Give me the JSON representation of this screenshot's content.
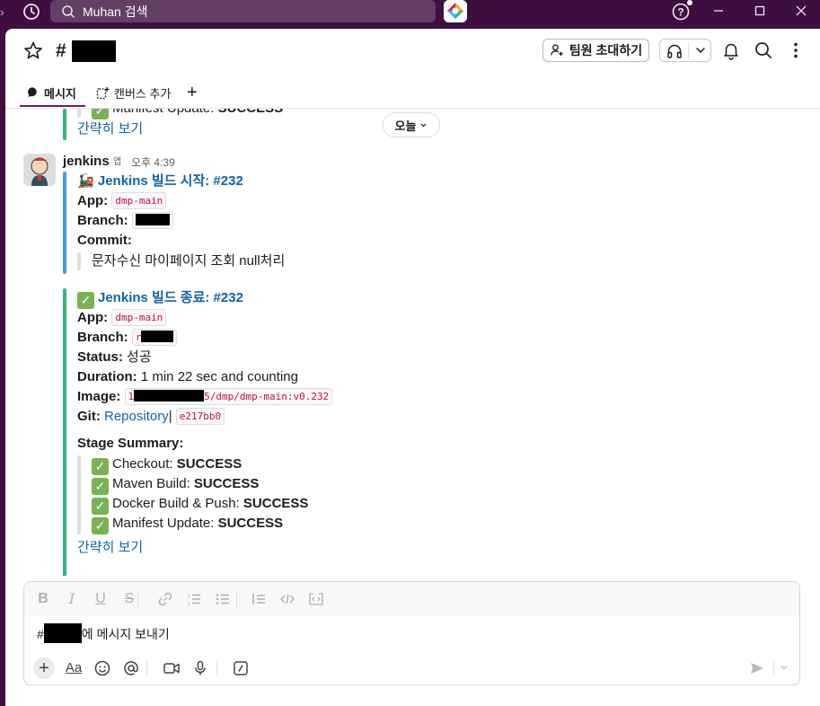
{
  "topbar": {
    "search_text": "Muhan 검색"
  },
  "header": {
    "hash": "#",
    "invite_label": "팀원 초대하기"
  },
  "tabs": {
    "messages": "메시지",
    "canvas": "캔버스 추가",
    "add": "+"
  },
  "date_pill": "오늘",
  "prev_message": {
    "manifest_label": "Manifest Update: ",
    "manifest_status": "SUCCESS",
    "collapse": "간략히 보기"
  },
  "message": {
    "sender": "jenkins",
    "badge": "앱",
    "time": "오후 4:39",
    "start": {
      "title": "Jenkins 빌드 시작: #232",
      "app_label": "App:",
      "app_value": "dmp-main",
      "branch_label": "Branch:",
      "commit_label": "Commit:",
      "commit_text": "문자수신 마이페이지 조회 null처리"
    },
    "finish": {
      "title": "Jenkins 빌드 종료: #232",
      "app_label": "App:",
      "app_value": "dmp-main",
      "branch_label": "Branch:",
      "branch_visible": "r",
      "status_label": "Status:",
      "status_value": "성공",
      "duration_label": "Duration:",
      "duration_value": "1 min 22 sec and counting",
      "image_label": "Image:",
      "image_prefix": "1",
      "image_suffix": "5/dmp/dmp-main:v0.232",
      "git_label": "Git:",
      "git_link": "Repository",
      "git_sep": "|",
      "git_commit": "e217bb0",
      "summary_label": "Stage Summary:",
      "stages": [
        {
          "name": "Checkout: ",
          "status": "SUCCESS"
        },
        {
          "name": "Maven Build: ",
          "status": "SUCCESS"
        },
        {
          "name": "Docker Build & Push: ",
          "status": "SUCCESS"
        },
        {
          "name": "Manifest Update: ",
          "status": "SUCCESS"
        }
      ],
      "collapse": "간략히 보기"
    }
  },
  "composer": {
    "prefix": "#",
    "placeholder_suffix": "에 메시지 보내기"
  },
  "colors": {
    "sidebar_purple": "#3f0e40",
    "start_bar": "#439fe0",
    "finish_bar": "#2eb67d",
    "link": "#1264a3"
  }
}
